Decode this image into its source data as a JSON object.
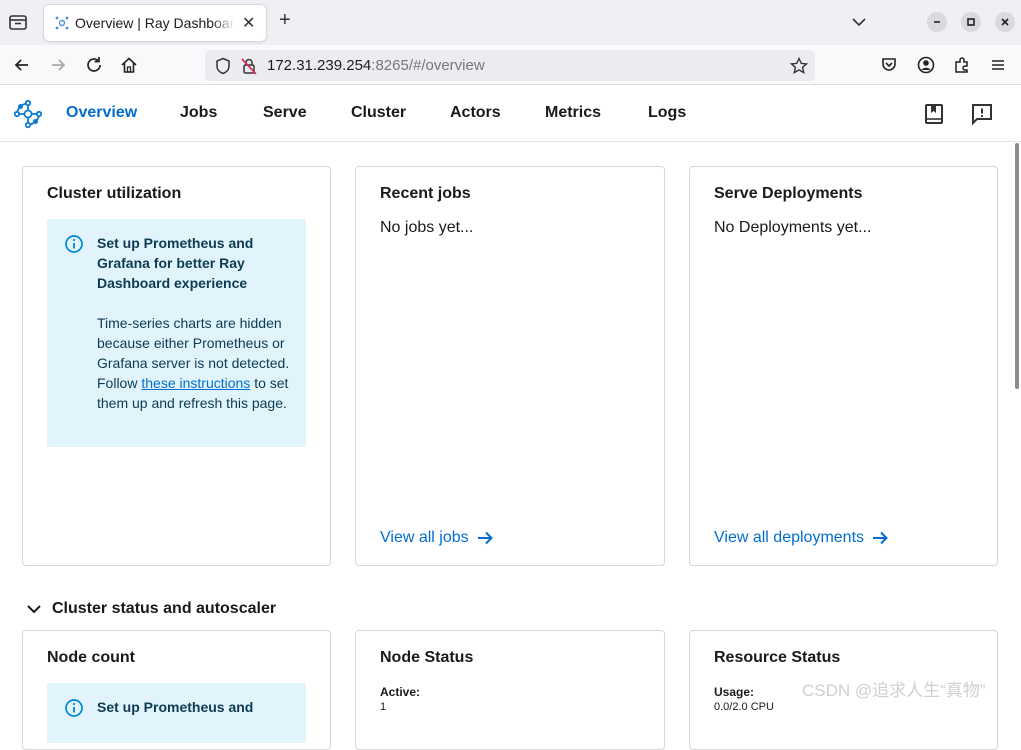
{
  "browser": {
    "tab_title": "Overview | Ray Dashboard",
    "url_host": "172.31.239.254",
    "url_rest": ":8265/#/overview"
  },
  "app": {
    "nav": [
      "Overview",
      "Jobs",
      "Serve",
      "Cluster",
      "Actors",
      "Metrics",
      "Logs"
    ],
    "active_nav": "Overview",
    "accent_color": "#036dcf"
  },
  "cards": {
    "cluster_utilization": {
      "title": "Cluster utilization",
      "info_title": "Set up Prometheus and Grafana for better Ray Dashboard experience",
      "info_body_before": "Time-series charts are hidden because either Prometheus or Grafana server is not detected. Follow ",
      "info_link": "these instructions",
      "info_body_after": " to set them up and refresh this page."
    },
    "recent_jobs": {
      "title": "Recent jobs",
      "empty": "No jobs yet...",
      "link": "View all jobs"
    },
    "serve_deployments": {
      "title": "Serve Deployments",
      "empty": "No Deployments yet...",
      "link": "View all deployments"
    }
  },
  "section": {
    "title": "Cluster status and autoscaler",
    "node_count": {
      "title": "Node count",
      "info_title": "Set up Prometheus and"
    },
    "node_status": {
      "title": "Node Status",
      "label": "Active:",
      "value": "1"
    },
    "resource_status": {
      "title": "Resource Status",
      "label": "Usage:",
      "value": "0.0/2.0 CPU"
    }
  },
  "watermark": "CSDN @追求人生“真物”"
}
